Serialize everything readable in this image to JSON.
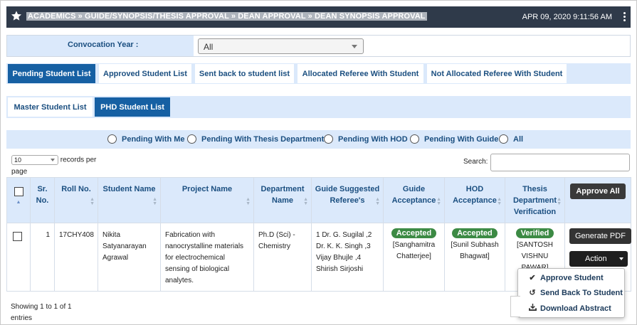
{
  "header": {
    "breadcrumb": "ACADEMICS » GUIDE/SYNOPSIS/THESIS APPROVAL » DEAN APPROVAL » DEAN SYNOPSIS APPROVAL",
    "datetime": "APR 09, 2020  9:11:56 AM"
  },
  "convocation": {
    "label": "Convocation Year :",
    "value": "All"
  },
  "tabs_main": [
    "Pending Student List",
    "Approved Student List",
    "Sent back to student list",
    "Allocated Referee With Student",
    "Not Allocated Referee With Student"
  ],
  "tabs_sub": [
    "Master Student List",
    "PHD Student List"
  ],
  "filters": [
    "Pending With Me",
    "Pending With Thesis Department",
    "Pending With HOD",
    "Pending With Guide",
    "All"
  ],
  "records": {
    "value": "10",
    "label": "records per",
    "label2": "page"
  },
  "search": {
    "label": "Search:"
  },
  "table": {
    "headers": {
      "sr": "Sr. No.",
      "roll": "Roll No.",
      "name": "Student Name",
      "project": "Project Name",
      "dept": "Department Name",
      "referees": "Guide Suggested Referee's",
      "guide": "Guide Acceptance",
      "hod": "HOD Acceptance",
      "thesis": "Thesis Department Verification"
    },
    "approve_all": "Approve All",
    "rows": [
      {
        "sr": "1",
        "roll": "17CHY408",
        "name": "Nikita Satyanarayan Agrawal",
        "project": "Fabrication with nanocrystalline materials for electrochemical sensing of biological analytes.",
        "dept": "Ph.D (Sci) - Chemistry",
        "referees": "1 Dr. G. Sugilal ,2 Dr. K. K. Singh ,3 Vijay Bhujle ,4 Shirish Sirjoshi",
        "guide_status": "Accepted",
        "guide_name": "[Sanghamitra Chatterjee]",
        "hod_status": "Accepted",
        "hod_name": "[Sunil Subhash Bhagwat]",
        "thesis_status": "Verified",
        "thesis_name": "[SANTOSH VISHNU PAWAR]",
        "generate_pdf": "Generate PDF",
        "action": "Action"
      }
    ]
  },
  "action_menu": {
    "approve": "Approve Student",
    "send_back": "Send Back To Student",
    "download": "Download Abstract"
  },
  "footer": {
    "showing": "Showing 1 to 1 of 1",
    "showing2": "entries"
  },
  "colors": {
    "topbar": "#2f3a4a",
    "active_tab": "#1660a3",
    "light_blue": "#dbe9fb",
    "badge_green": "#3c8a44"
  }
}
